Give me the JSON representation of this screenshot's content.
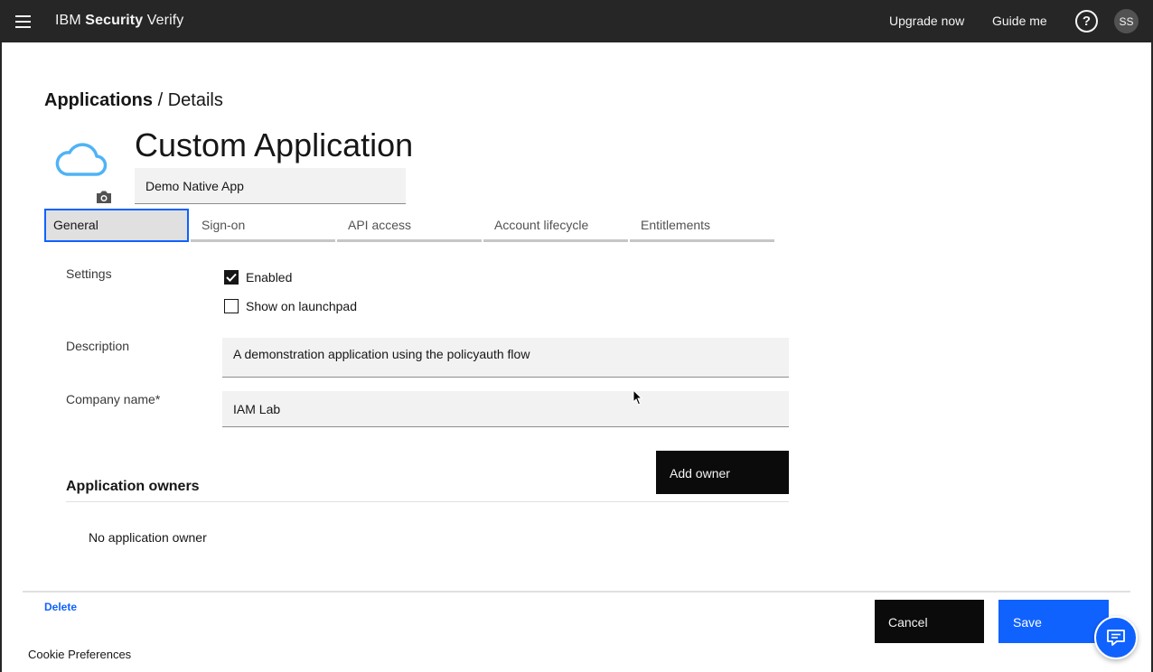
{
  "header": {
    "brand_prefix": "IBM",
    "brand_strong": "Security",
    "brand_suffix": "Verify",
    "upgrade_label": "Upgrade now",
    "guide_label": "Guide me",
    "help_glyph": "?",
    "avatar_initials": "SS"
  },
  "breadcrumb": {
    "parent": "Applications",
    "separator": "/",
    "current": "Details"
  },
  "app": {
    "title": "Custom Application",
    "name_value": "Demo Native App",
    "icon": "cloud-icon"
  },
  "tabs": [
    {
      "label": "General",
      "active": true
    },
    {
      "label": "Sign-on",
      "active": false
    },
    {
      "label": "API access",
      "active": false
    },
    {
      "label": "Account lifecycle",
      "active": false
    },
    {
      "label": "Entitlements",
      "active": false
    }
  ],
  "form": {
    "settings_label": "Settings",
    "enabled_label": "Enabled",
    "enabled_checked": true,
    "launchpad_label": "Show on launchpad",
    "launchpad_checked": false,
    "description_label": "Description",
    "description_value": "A demonstration application using the policyauth flow",
    "company_label": "Company name*",
    "company_value": "IAM Lab"
  },
  "owners": {
    "heading": "Application owners",
    "add_label": "Add owner",
    "empty_text": "No application owner"
  },
  "footer": {
    "delete_label": "Delete",
    "cookie_label": "Cookie Preferences",
    "cancel_label": "Cancel",
    "save_label": "Save"
  },
  "colors": {
    "header_bg": "#262626",
    "accent": "#0f62fe",
    "button_dark": "#0b0b0b",
    "field_bg": "#f2f2f2",
    "cloud": "#4fb3f6"
  }
}
